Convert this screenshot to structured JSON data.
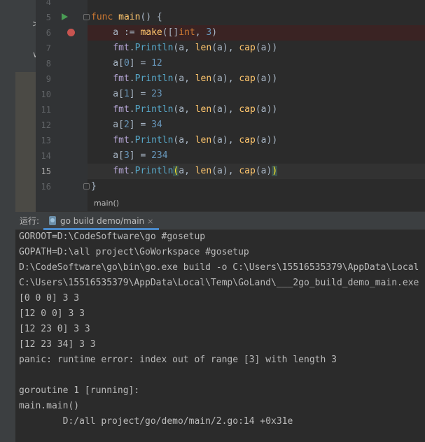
{
  "editor": {
    "lines": [
      {
        "num": "4"
      },
      {
        "num": "5",
        "tokens": [
          {
            "t": "func",
            "c": "kw"
          },
          {
            "t": " ",
            "c": "plain"
          },
          {
            "t": "main",
            "c": "fn"
          },
          {
            "t": "() {",
            "c": "plain"
          }
        ]
      },
      {
        "num": "6",
        "tokens": [
          {
            "t": "    a := ",
            "c": "plain"
          },
          {
            "t": "make",
            "c": "fn"
          },
          {
            "t": "([]",
            "c": "plain"
          },
          {
            "t": "int",
            "c": "kw"
          },
          {
            "t": ", ",
            "c": "plain"
          },
          {
            "t": "3",
            "c": "num"
          },
          {
            "t": ")",
            "c": "plain"
          }
        ]
      },
      {
        "num": "7",
        "tokens": [
          {
            "t": "    fmt",
            "c": "pkg"
          },
          {
            "t": ".",
            "c": "plain"
          },
          {
            "t": "Println",
            "c": "call"
          },
          {
            "t": "(a, ",
            "c": "plain"
          },
          {
            "t": "len",
            "c": "fn"
          },
          {
            "t": "(a), ",
            "c": "plain"
          },
          {
            "t": "cap",
            "c": "fn"
          },
          {
            "t": "(a))",
            "c": "plain"
          }
        ]
      },
      {
        "num": "8",
        "tokens": [
          {
            "t": "    a[",
            "c": "plain"
          },
          {
            "t": "0",
            "c": "num"
          },
          {
            "t": "] = ",
            "c": "plain"
          },
          {
            "t": "12",
            "c": "num"
          }
        ]
      },
      {
        "num": "9",
        "tokens": [
          {
            "t": "    fmt",
            "c": "pkg"
          },
          {
            "t": ".",
            "c": "plain"
          },
          {
            "t": "Println",
            "c": "call"
          },
          {
            "t": "(a, ",
            "c": "plain"
          },
          {
            "t": "len",
            "c": "fn"
          },
          {
            "t": "(a), ",
            "c": "plain"
          },
          {
            "t": "cap",
            "c": "fn"
          },
          {
            "t": "(a))",
            "c": "plain"
          }
        ]
      },
      {
        "num": "10",
        "tokens": [
          {
            "t": "    a[",
            "c": "plain"
          },
          {
            "t": "1",
            "c": "num"
          },
          {
            "t": "] = ",
            "c": "plain"
          },
          {
            "t": "23",
            "c": "num"
          }
        ]
      },
      {
        "num": "11",
        "tokens": [
          {
            "t": "    fmt",
            "c": "pkg"
          },
          {
            "t": ".",
            "c": "plain"
          },
          {
            "t": "Println",
            "c": "call"
          },
          {
            "t": "(a, ",
            "c": "plain"
          },
          {
            "t": "len",
            "c": "fn"
          },
          {
            "t": "(a), ",
            "c": "plain"
          },
          {
            "t": "cap",
            "c": "fn"
          },
          {
            "t": "(a))",
            "c": "plain"
          }
        ]
      },
      {
        "num": "12",
        "tokens": [
          {
            "t": "    a[",
            "c": "plain"
          },
          {
            "t": "2",
            "c": "num"
          },
          {
            "t": "] = ",
            "c": "plain"
          },
          {
            "t": "34",
            "c": "num"
          }
        ]
      },
      {
        "num": "13",
        "tokens": [
          {
            "t": "    fmt",
            "c": "pkg"
          },
          {
            "t": ".",
            "c": "plain"
          },
          {
            "t": "Println",
            "c": "call"
          },
          {
            "t": "(a, ",
            "c": "plain"
          },
          {
            "t": "len",
            "c": "fn"
          },
          {
            "t": "(a), ",
            "c": "plain"
          },
          {
            "t": "cap",
            "c": "fn"
          },
          {
            "t": "(a))",
            "c": "plain"
          }
        ]
      },
      {
        "num": "14",
        "tokens": [
          {
            "t": "    a[",
            "c": "plain"
          },
          {
            "t": "3",
            "c": "num"
          },
          {
            "t": "] = ",
            "c": "plain"
          },
          {
            "t": "234",
            "c": "num"
          }
        ]
      },
      {
        "num": "15",
        "tokens": [
          {
            "t": "    fmt",
            "c": "pkg"
          },
          {
            "t": ".",
            "c": "plain"
          },
          {
            "t": "Println",
            "c": "call"
          },
          {
            "t": "(",
            "c": "paren-hl"
          },
          {
            "t": "a, ",
            "c": "plain"
          },
          {
            "t": "len",
            "c": "fn"
          },
          {
            "t": "(a), ",
            "c": "plain"
          },
          {
            "t": "cap",
            "c": "fn"
          },
          {
            "t": "(a)",
            "c": "plain"
          },
          {
            "t": ")",
            "c": "paren-hl"
          }
        ]
      },
      {
        "num": "16",
        "tokens": [
          {
            "t": "}",
            "c": "plain"
          }
        ]
      }
    ],
    "breadcrumb": "main()",
    "breakpoint_line": "6",
    "current_line": "15"
  },
  "project_tree": {
    "glyphs": [
      ">",
      ">",
      "∨"
    ]
  },
  "run_window": {
    "label": "运行:",
    "tab_label": "go build demo/main",
    "tab_close": "×",
    "console_lines": [
      "GOROOT=D:\\CodeSoftware\\go #gosetup",
      "GOPATH=D:\\all project\\GoWorkspace #gosetup",
      "D:\\CodeSoftware\\go\\bin\\go.exe build -o C:\\Users\\15516535379\\AppData\\Local",
      "C:\\Users\\15516535379\\AppData\\Local\\Temp\\GoLand\\___2go_build_demo_main.exe",
      "[0 0 0] 3 3",
      "[12 0 0] 3 3",
      "[12 23 0] 3 3",
      "[12 23 34] 3 3",
      "panic: runtime error: index out of range [3] with length 3",
      "",
      "goroutine 1 [running]:",
      "main.main()",
      "        D:/all project/go/demo/main/2.go:14 +0x31e"
    ]
  },
  "colors": {
    "keyword": "#cc7832",
    "function": "#ffc66d",
    "number": "#6897bb",
    "breakpoint": "#c75450",
    "run": "#499c54"
  }
}
